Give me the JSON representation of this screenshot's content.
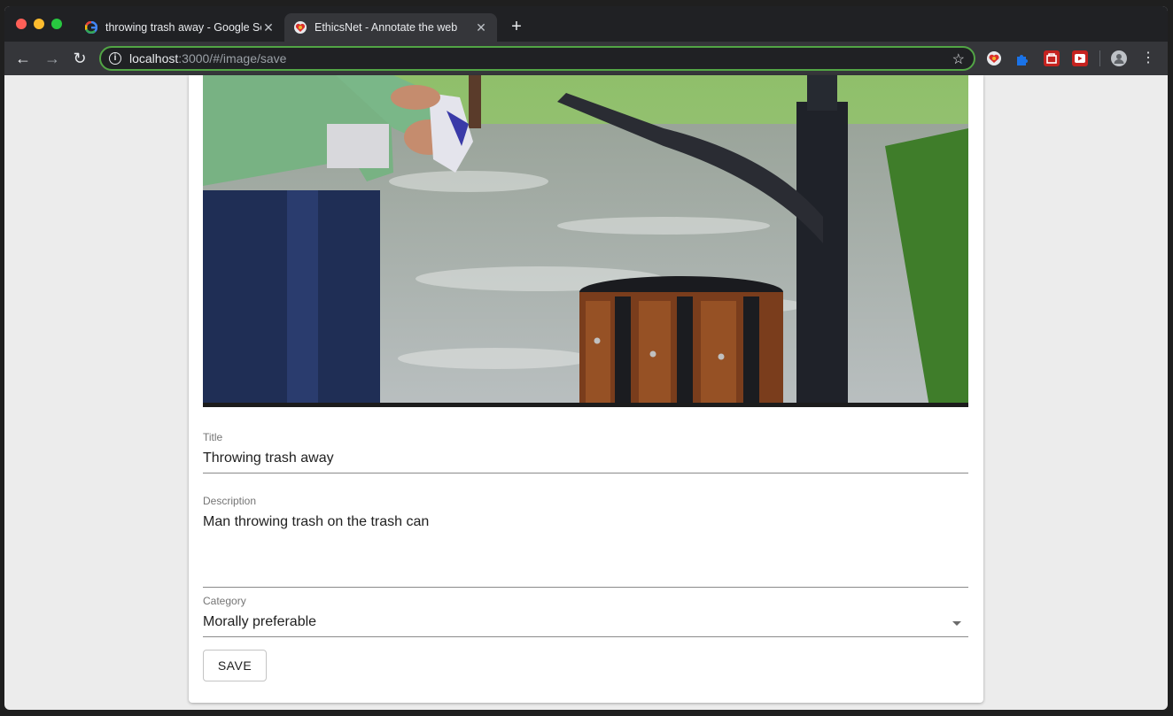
{
  "browser": {
    "tabs": [
      {
        "title": "throwing trash away - Google Search",
        "icon": "google-icon",
        "active": false
      },
      {
        "title": "EthicsNet - Annotate the web",
        "icon": "ethicsnet-icon",
        "active": true
      }
    ],
    "address": {
      "host": "localhost",
      "path": ":3000/#/image/save"
    },
    "extensions": [
      "ethicsnet-extension-icon",
      "puzzle-extension-icon",
      "red-extension-icon",
      "red-play-extension-icon"
    ]
  },
  "form": {
    "image_alt": "Man throwing trash into a wooden trash can in a park",
    "title_label": "Title",
    "title_value": "Throwing trash away",
    "description_label": "Description",
    "description_value": "Man throwing trash on the trash can",
    "category_label": "Category",
    "category_value": "Morally preferable",
    "save_label": "SAVE"
  },
  "colors": {
    "accent_green": "#52a545",
    "tab_bg": "#35363a"
  }
}
